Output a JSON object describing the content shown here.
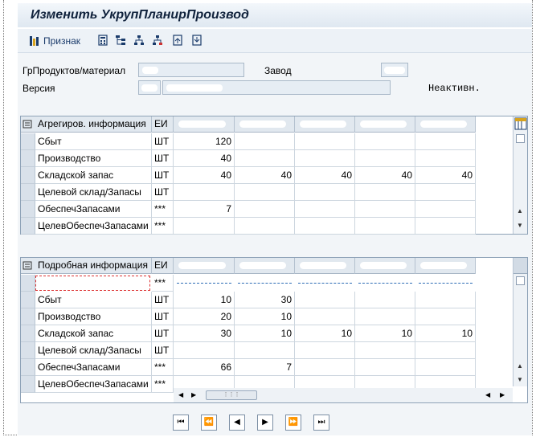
{
  "title": "Изменить УкрупПланирПроизвод",
  "toolbar": {
    "attr_label": "Признак",
    "icons": [
      "attribute-icon",
      "calculator-icon",
      "hierarchy-icon",
      "tree-expand-icon",
      "tree-collapse-icon",
      "save-layout-icon",
      "load-layout-icon"
    ]
  },
  "header": {
    "group_label": "ГрПродуктов/материал",
    "plant_label": "Завод",
    "version_label": "Версия",
    "inactive_label": "Неактивн."
  },
  "agg": {
    "title_col": "Агрегиров. информация",
    "unit_col": "ЕИ",
    "rows": [
      {
        "label": "Сбыт",
        "unit": "ШТ",
        "vals": [
          "120",
          "",
          "",
          "",
          ""
        ]
      },
      {
        "label": "Производство",
        "unit": "ШТ",
        "vals": [
          "40",
          "",
          "",
          "",
          ""
        ]
      },
      {
        "label": "Складской запас",
        "unit": "ШТ",
        "vals": [
          "40",
          "40",
          "40",
          "40",
          "40"
        ]
      },
      {
        "label": "Целевой склад/Запасы",
        "unit": "ШТ",
        "vals": [
          "",
          "",
          "",
          "",
          ""
        ]
      },
      {
        "label": "ОбеспечЗапасами",
        "unit": "***",
        "vals": [
          "7",
          "",
          "",
          "",
          ""
        ]
      },
      {
        "label": "ЦелевОбеспечЗапасами",
        "unit": "***",
        "vals": [
          "",
          "",
          "",
          "",
          ""
        ]
      }
    ]
  },
  "det": {
    "title_col": "Подробная информация",
    "unit_col": "ЕИ",
    "first_row_unit": "***",
    "rows": [
      {
        "label": "Сбыт",
        "unit": "ШТ",
        "vals": [
          "10",
          "30",
          "",
          "",
          ""
        ]
      },
      {
        "label": "Производство",
        "unit": "ШТ",
        "vals": [
          "20",
          "10",
          "",
          "",
          ""
        ]
      },
      {
        "label": "Складской запас",
        "unit": "ШТ",
        "vals": [
          "30",
          "10",
          "10",
          "10",
          "10"
        ]
      },
      {
        "label": "Целевой склад/Запасы",
        "unit": "ШТ",
        "vals": [
          "",
          "",
          "",
          "",
          ""
        ]
      },
      {
        "label": "ОбеспечЗапасами",
        "unit": "***",
        "vals": [
          "66",
          "7",
          "",
          "",
          ""
        ]
      },
      {
        "label": "ЦелевОбеспечЗапасами",
        "unit": "***",
        "vals": [
          "",
          "",
          "",
          "",
          ""
        ]
      }
    ]
  },
  "nav": {
    "first": "⏮",
    "prev_page": "⏪",
    "prev": "◀",
    "next": "▶",
    "next_page": "⏩",
    "last": "⏭"
  }
}
